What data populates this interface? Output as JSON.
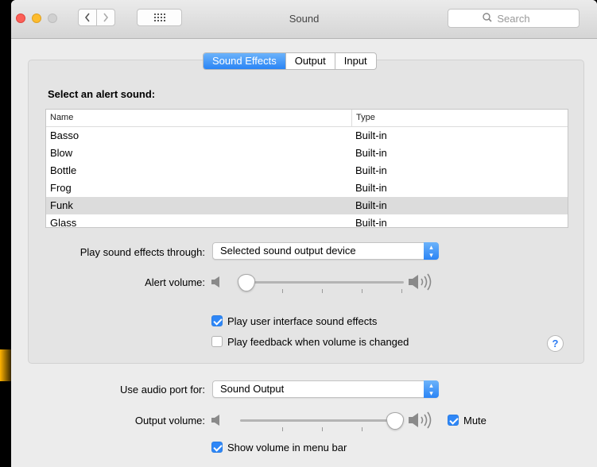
{
  "window": {
    "title": "Sound"
  },
  "toolbar": {
    "search_placeholder": "Search"
  },
  "tabs": [
    {
      "label": "Sound Effects",
      "selected": true
    },
    {
      "label": "Output",
      "selected": false
    },
    {
      "label": "Input",
      "selected": false
    }
  ],
  "sound_effects": {
    "heading": "Select an alert sound:",
    "columns": [
      "Name",
      "Type"
    ],
    "rows": [
      {
        "name": "Basso",
        "type": "Built-in"
      },
      {
        "name": "Blow",
        "type": "Built-in"
      },
      {
        "name": "Bottle",
        "type": "Built-in"
      },
      {
        "name": "Frog",
        "type": "Built-in"
      },
      {
        "name": "Funk",
        "type": "Built-in"
      },
      {
        "name": "Glass",
        "type": "Built-in"
      }
    ],
    "selected_row": "Funk",
    "play_through_label": "Play sound effects through:",
    "play_through_value": "Selected sound output device",
    "alert_volume_label": "Alert volume:",
    "alert_volume_level": 0.05,
    "ui_sounds_label": "Play user interface sound effects",
    "ui_sounds_checked": true,
    "feedback_label": "Play feedback when volume is changed",
    "feedback_checked": false,
    "help_label": "?"
  },
  "bottom": {
    "audio_port_label": "Use audio port for:",
    "audio_port_value": "Sound Output",
    "output_volume_label": "Output volume:",
    "output_volume_level": 0.95,
    "mute_label": "Mute",
    "mute_checked": true,
    "show_volume_label": "Show volume in menu bar",
    "show_volume_checked": true
  },
  "colors": {
    "accent": "#2f87f7",
    "close": "#fc5f57",
    "minimize": "#fdbc2e",
    "zoom_disabled": "#d0d0d0"
  },
  "icons": [
    "back-icon",
    "forward-icon",
    "grid-icon",
    "search-icon",
    "speaker-low-icon",
    "speaker-high-icon",
    "help-icon",
    "popup-arrows-icon"
  ]
}
